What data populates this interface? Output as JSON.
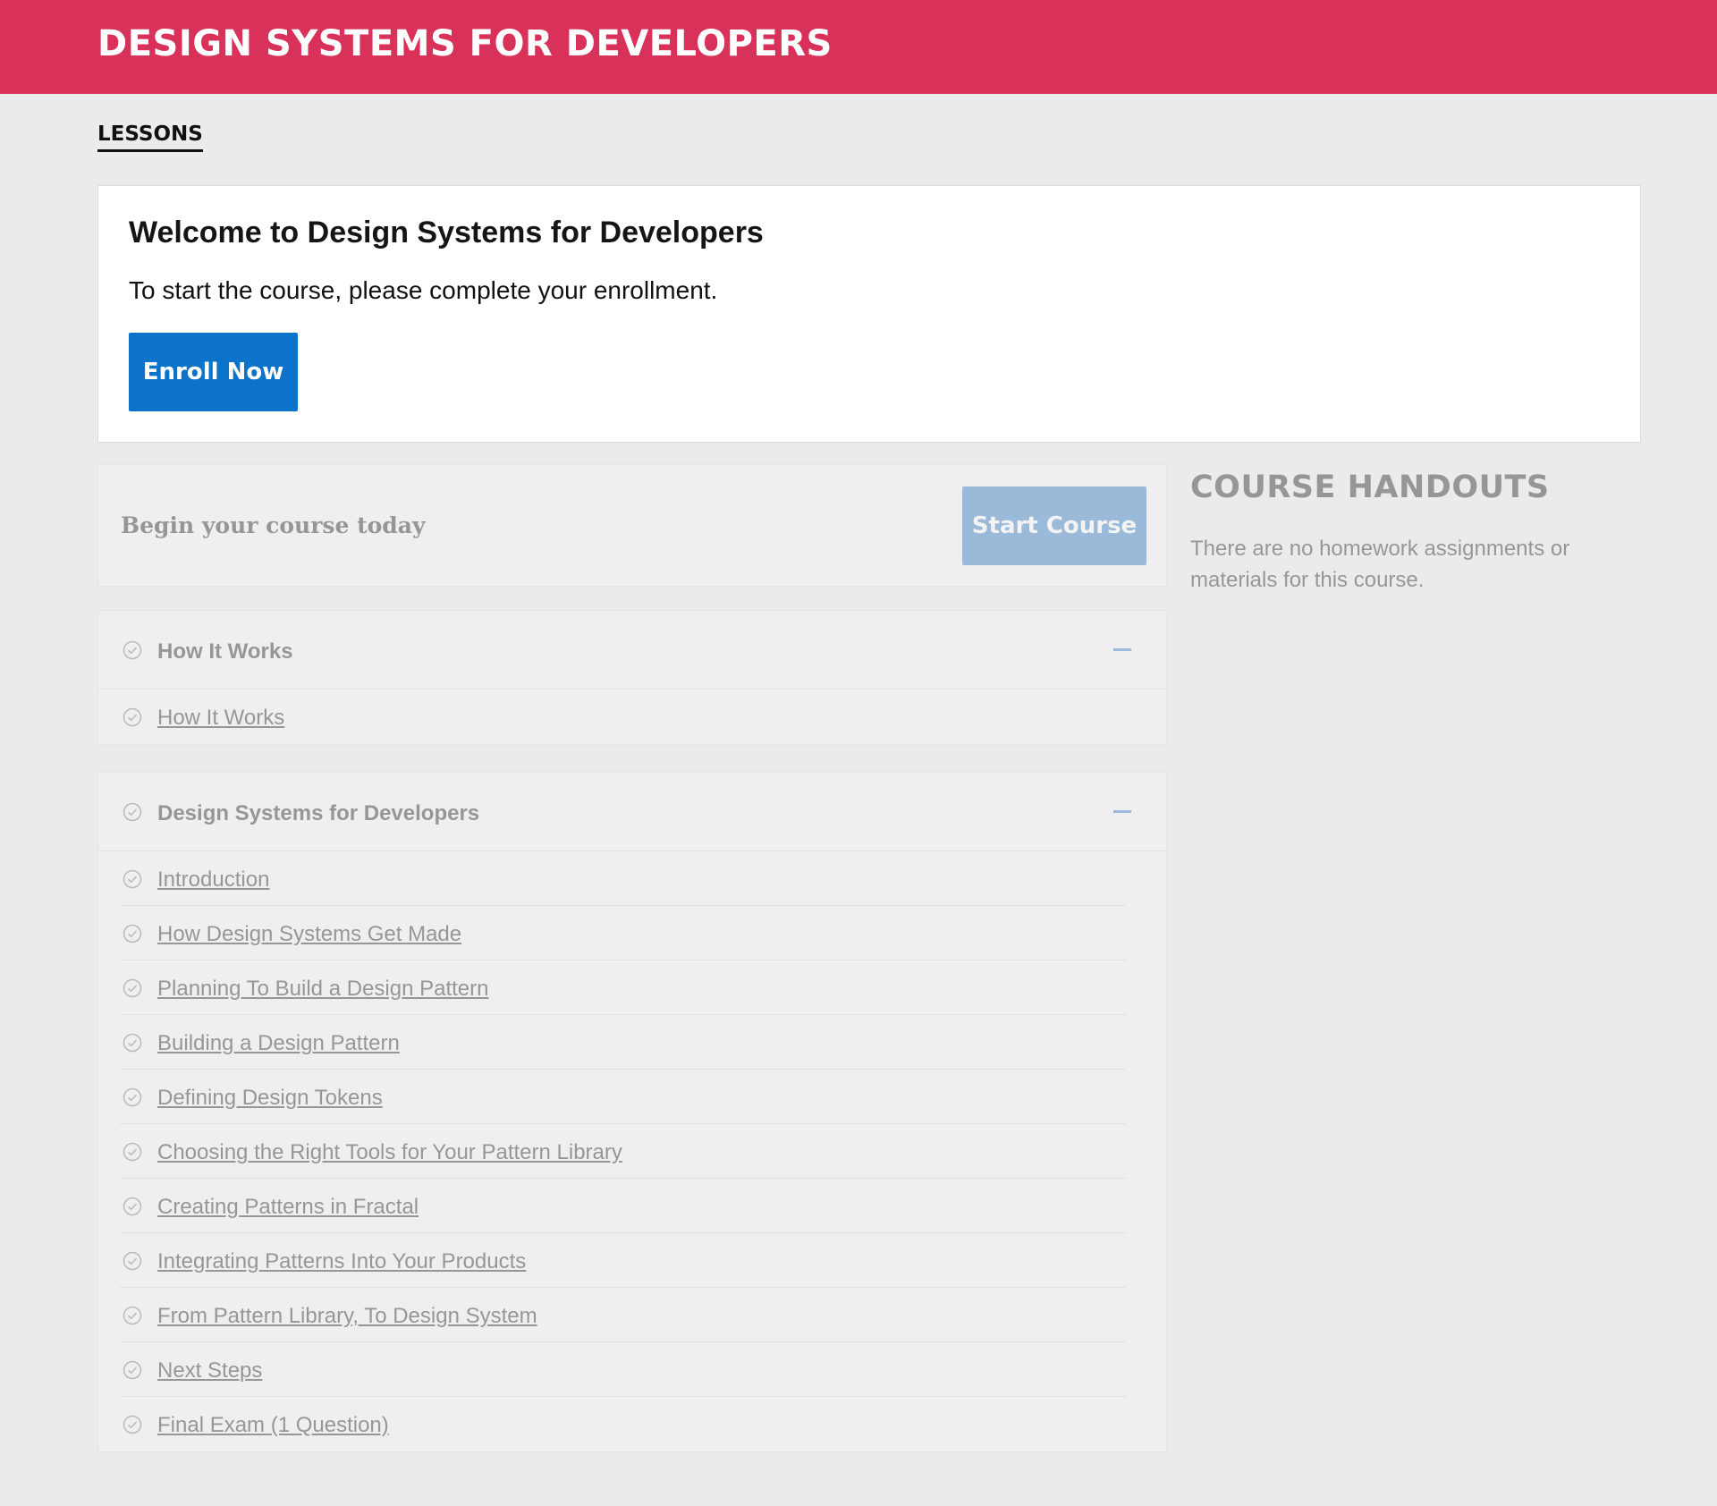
{
  "header": {
    "title": "DESIGN SYSTEMS FOR DEVELOPERS",
    "color": "#d8325a"
  },
  "nav": {
    "lessons_tab": "LESSONS"
  },
  "welcome": {
    "title": "Welcome to Design Systems for Developers",
    "text": "To start the course, please complete your enrollment.",
    "enroll_label": "Enroll Now",
    "button_color": "#0b73c9"
  },
  "begin": {
    "text": "Begin your course today",
    "start_label": "Start Course"
  },
  "sections": [
    {
      "title": "How It Works",
      "lessons": [
        "How It Works"
      ]
    },
    {
      "title": "Design Systems for Developers",
      "lessons": [
        "Introduction",
        "How Design Systems Get Made",
        "Planning To Build a Design Pattern",
        "Building a Design Pattern",
        "Defining Design Tokens",
        "Choosing the Right Tools for Your Pattern Library",
        "Creating Patterns in Fractal",
        "Integrating Patterns Into Your Products",
        "From Pattern Library, To Design System",
        "Next Steps",
        "Final Exam (1 Question)"
      ]
    }
  ],
  "handouts": {
    "title": "COURSE HANDOUTS",
    "text": "There are no homework assignments or materials for this course."
  },
  "icons": {
    "lesson_status": "check-circle-icon",
    "section_toggle": "minus-icon"
  }
}
